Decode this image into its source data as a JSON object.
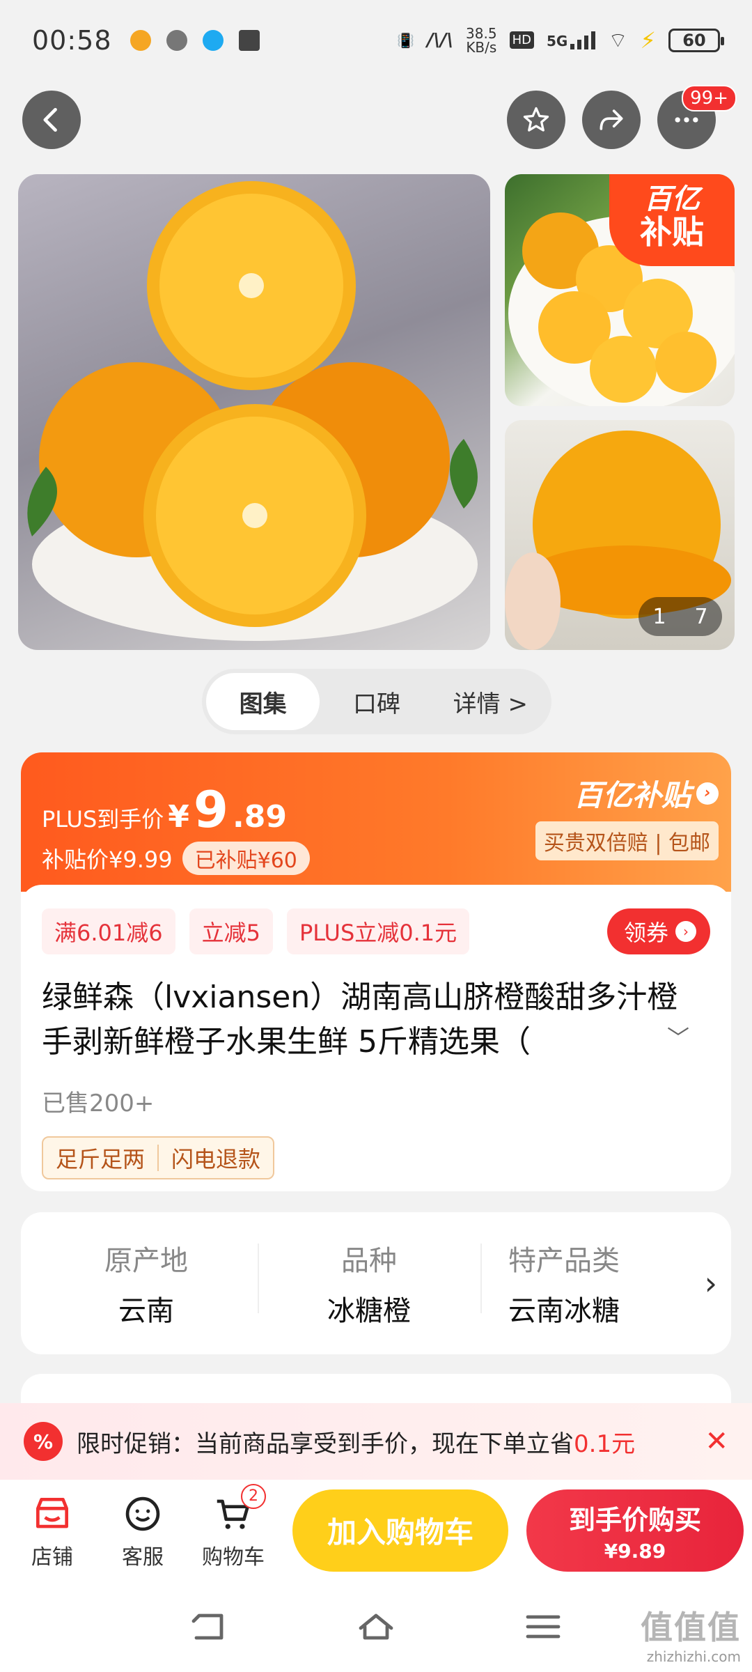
{
  "status_bar": {
    "time": "00:58",
    "net_speed_value": "38.5",
    "net_speed_unit": "KB/s",
    "hd": "HD",
    "network": "5G",
    "battery": "60"
  },
  "top_nav": {
    "more_badge": "99+"
  },
  "gallery": {
    "subsidy_line1": "百亿",
    "subsidy_line2": "补贴",
    "page_current": "1",
    "page_total": "7"
  },
  "tabs": [
    {
      "label": "图集"
    },
    {
      "label": "口碑"
    },
    {
      "label": "详情 >"
    }
  ],
  "price": {
    "plus_label": "PLUS到手价",
    "currency": "¥",
    "integer": "9",
    "decimal": ".89",
    "subsidy_price": "补贴价¥9.99",
    "subsidized": "已补贴¥60",
    "brand": "百亿补贴",
    "guarantee": "买贵双倍赔 | 包邮"
  },
  "promo_tags": [
    "满6.01减6",
    "立减5",
    "PLUS立减0.1元"
  ],
  "coupon_label": "领券",
  "product": {
    "title": "绿鲜森（lvxiansen）湖南高山脐橙酸甜多汁橙手剥新鲜橙子水果生鲜 5斤精选果（",
    "sold": "已售200+",
    "services": [
      "足斤足两",
      "闪电退款"
    ]
  },
  "specs": [
    {
      "key": "原产地",
      "value": "云南"
    },
    {
      "key": "品种",
      "value": "冰糖橙"
    },
    {
      "key": "特产品类",
      "value": "云南冰糖"
    }
  ],
  "promo_bar": {
    "icon": "%",
    "text": "限时促销：当前商品享受到手价，现在下单立省",
    "amount": "0.1元"
  },
  "bottom_bar": {
    "store": "店铺",
    "service": "客服",
    "cart": "购物车",
    "cart_count": "2",
    "add_to_cart": "加入购物车",
    "buy_line1": "到手价购买",
    "buy_line2": "¥9.89"
  },
  "watermark": {
    "logo": "值值值",
    "site": "zhizhizhi.com"
  }
}
